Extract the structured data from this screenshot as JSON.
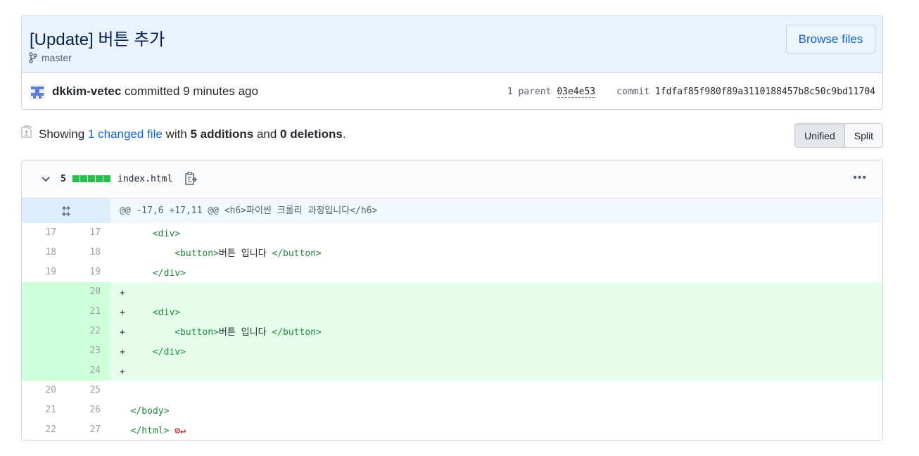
{
  "commit": {
    "title": "[Update] 버튼 추가",
    "branch": "master",
    "browse_label": "Browse files",
    "author": "dkkim-vetec",
    "action": " committed ",
    "time": "9 minutes ago",
    "parent_label": "1 parent",
    "parent_sha": "03e4e53",
    "commit_label": "commit",
    "commit_sha": "1fdfaf85f980f89a3110188457b8c50c9bd11704"
  },
  "summary": {
    "showing": "Showing ",
    "changed": "1 changed file",
    "with": " with ",
    "additions": "5 additions",
    "and": " and ",
    "deletions": "0 deletions",
    "period": "."
  },
  "view_toggle": {
    "unified": "Unified",
    "split": "Split"
  },
  "file": {
    "changes": "5",
    "name": "index.html",
    "hunk": "@@ -17,6 +17,11 @@ <h6>파이썬 크롤리 과정입니다</h6>",
    "lines": [
      {
        "old": "17",
        "new": "17",
        "type": "ctx",
        "pre": "      ",
        "t1": "<div>",
        "txt": "",
        "t2": ""
      },
      {
        "old": "18",
        "new": "18",
        "type": "ctx",
        "pre": "          ",
        "t1": "<button>",
        "txt": "버튼 입니다 ",
        "t2": "</button>"
      },
      {
        "old": "19",
        "new": "19",
        "type": "ctx",
        "pre": "      ",
        "t1": "</div>",
        "txt": "",
        "t2": ""
      },
      {
        "old": "",
        "new": "20",
        "type": "add",
        "pre": "+",
        "t1": "",
        "txt": "",
        "t2": ""
      },
      {
        "old": "",
        "new": "21",
        "type": "add",
        "pre": "+     ",
        "t1": "<div>",
        "txt": "",
        "t2": ""
      },
      {
        "old": "",
        "new": "22",
        "type": "add",
        "pre": "+         ",
        "t1": "<button>",
        "txt": "버튼 입니다 ",
        "t2": "</button>"
      },
      {
        "old": "",
        "new": "23",
        "type": "add",
        "pre": "+     ",
        "t1": "</div>",
        "txt": "",
        "t2": ""
      },
      {
        "old": "",
        "new": "24",
        "type": "add",
        "pre": "+",
        "t1": "",
        "txt": "",
        "t2": ""
      },
      {
        "old": "20",
        "new": "25",
        "type": "ctx",
        "pre": "",
        "t1": "",
        "txt": "",
        "t2": ""
      },
      {
        "old": "21",
        "new": "26",
        "type": "ctx",
        "pre": "  ",
        "t1": "</body>",
        "txt": "",
        "t2": ""
      },
      {
        "old": "22",
        "new": "27",
        "type": "ctx",
        "pre": "  ",
        "t1": "</html>",
        "txt": "",
        "t2": "",
        "noeol": "⊘↵"
      }
    ]
  },
  "colors": {
    "added_bg": "#e6ffed",
    "added_num_bg": "#cdffd8",
    "link": "#0f62c6",
    "stat": "#2cbe4e"
  }
}
